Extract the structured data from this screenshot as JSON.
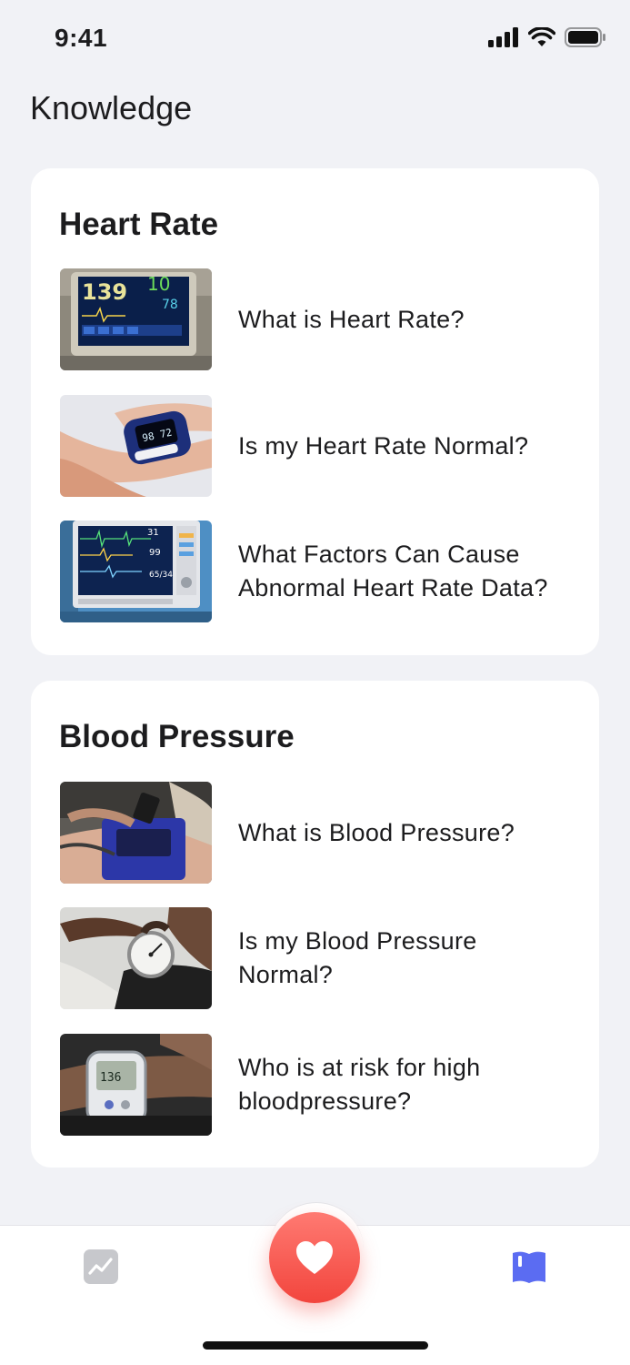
{
  "status_bar": {
    "time": "9:41"
  },
  "header": {
    "title": "Knowledge"
  },
  "sections": [
    {
      "title": "Heart Rate",
      "articles": [
        {
          "label": "What is Heart Rate?",
          "thumbnail": "patient-monitor-photo"
        },
        {
          "label": "Is my Heart Rate Normal?",
          "thumbnail": "pulse-oximeter-photo"
        },
        {
          "label": "What Factors Can Cause Abnormal Heart Rate Data?",
          "thumbnail": "ecg-monitor-photo"
        }
      ]
    },
    {
      "title": "Blood Pressure",
      "articles": [
        {
          "label": "What is Blood Pressure?",
          "thumbnail": "bp-cuff-photo"
        },
        {
          "label": "Is my Blood Pressure Normal?",
          "thumbnail": "sphygmomanometer-photo"
        },
        {
          "label": "Who is at risk for high bloodpressure?",
          "thumbnail": "wrist-monitor-photo"
        }
      ]
    }
  ],
  "tab_bar": {
    "tabs": [
      {
        "name": "trends",
        "icon": "trend-chart-icon",
        "active": false
      },
      {
        "name": "measure",
        "icon": "heart-icon",
        "active": false
      },
      {
        "name": "knowledge",
        "icon": "book-icon",
        "active": true
      }
    ]
  },
  "colors": {
    "background": "#f1f2f6",
    "accent": "#ff5a52",
    "active_tab": "#5b6cf2",
    "inactive_tab": "#c7c8cc"
  }
}
